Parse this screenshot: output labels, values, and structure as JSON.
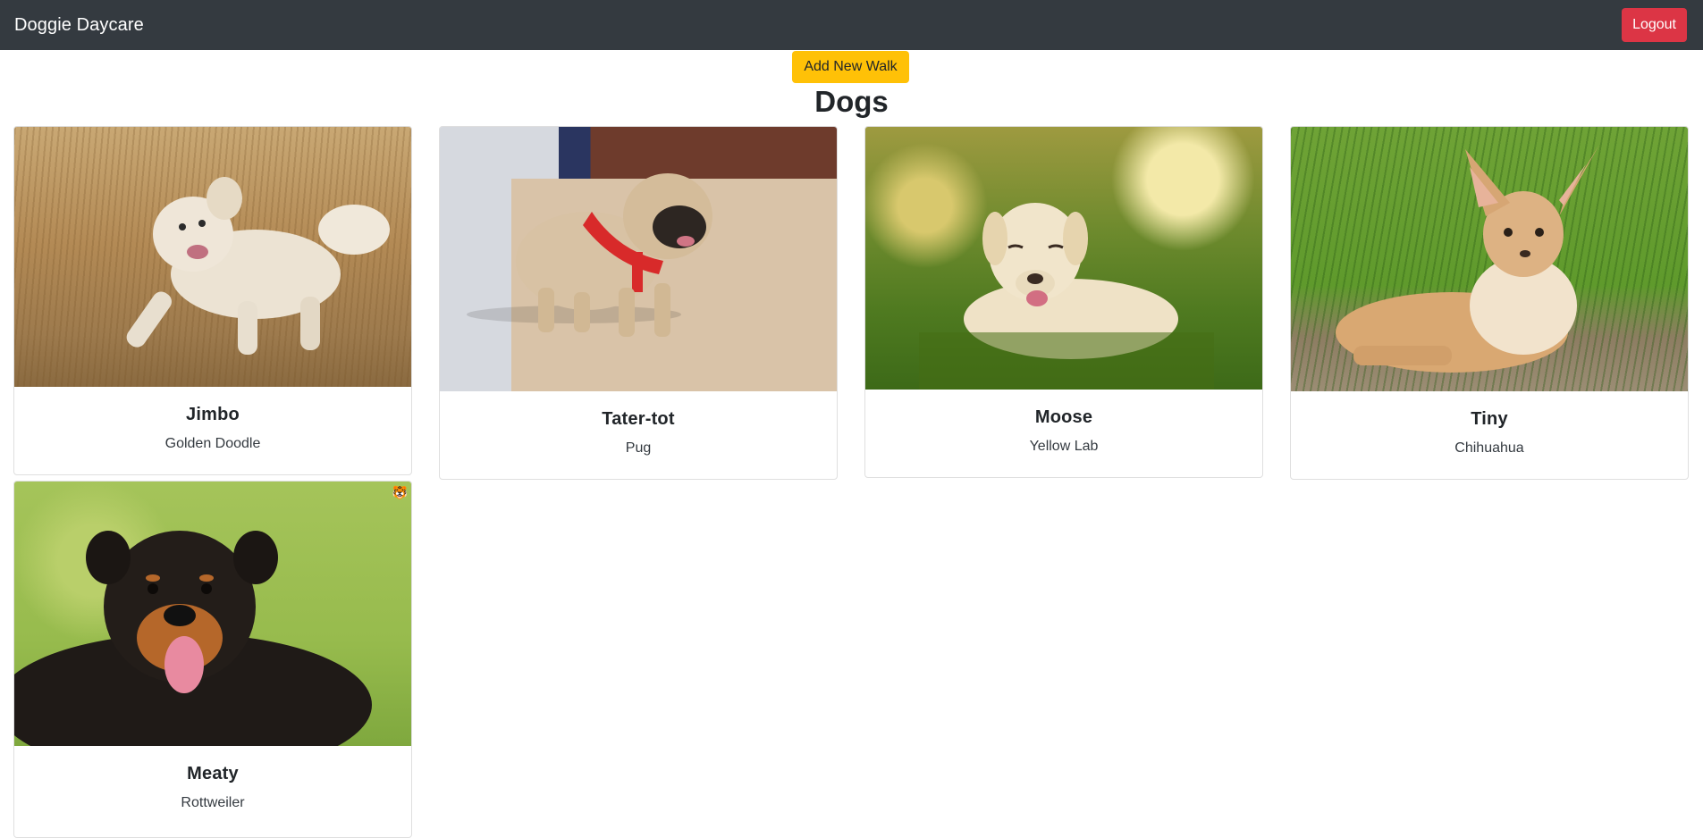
{
  "navbar": {
    "brand": "Doggie Daycare",
    "logout_label": "Logout"
  },
  "actions": {
    "add_walk_label": "Add New Walk"
  },
  "page": {
    "title": "Dogs"
  },
  "dogs": [
    {
      "name": "Jimbo",
      "breed": "Golden Doodle",
      "photo": "dog-photo"
    },
    {
      "name": "Tater-tot",
      "breed": "Pug",
      "photo": "dog-photo"
    },
    {
      "name": "Moose",
      "breed": "Yellow Lab",
      "photo": "dog-photo"
    },
    {
      "name": "Tiny",
      "breed": "Chihuahua",
      "photo": "dog-photo"
    },
    {
      "name": "Meaty",
      "breed": "Rottweiler",
      "photo": "dog-photo"
    }
  ],
  "colors": {
    "navbar_bg": "#343a40",
    "logout_bg": "#dc3545",
    "add_walk_bg": "#ffc107"
  }
}
